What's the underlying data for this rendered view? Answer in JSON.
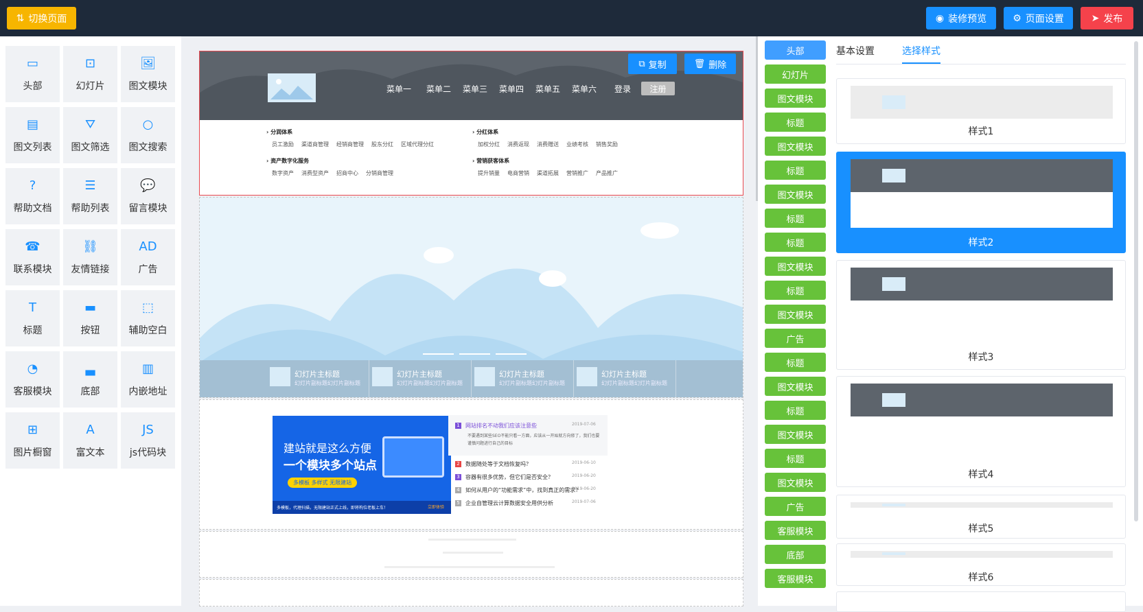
{
  "toolbar": {
    "switch_label": "切换页面",
    "preview_label": "装修预览",
    "settings_label": "页面设置",
    "publish_label": "发布"
  },
  "modules": [
    "头部",
    "幻灯片",
    "图文模块",
    "图文列表",
    "图文筛选",
    "图文搜索",
    "帮助文档",
    "帮助列表",
    "留言模块",
    "联系模块",
    "友情链接",
    "广告",
    "标题",
    "按钮",
    "辅助空白",
    "客服模块",
    "底部",
    "内嵌地址",
    "图片橱窗",
    "富文本",
    "js代码块"
  ],
  "module_icons": [
    "header-icon",
    "slideshow-icon",
    "image-text-icon",
    "image-list-icon",
    "filter-icon",
    "search-icon",
    "help-doc-icon",
    "help-list-icon",
    "message-icon",
    "contact-icon",
    "link-icon",
    "ad-icon",
    "title-icon",
    "button-icon",
    "blank-icon",
    "service-icon",
    "footer-icon",
    "embed-icon",
    "gallery-icon",
    "rich-text-icon",
    "js-code-icon"
  ],
  "canvas": {
    "copy_label": "复制",
    "delete_label": "删除",
    "menus": [
      "菜单一",
      "菜单二",
      "菜单三",
      "菜单四",
      "菜单五",
      "菜单六"
    ],
    "login": "登录",
    "register": "注册",
    "dropdown": [
      {
        "title": "分润体系",
        "items": [
          "员工激励",
          "渠道商管理",
          "经销商管理",
          "股东分红",
          "区域代理分红"
        ]
      },
      {
        "title": "分红体系",
        "items": [
          "加权分红",
          "消费返现",
          "消费赠送",
          "业绩考核",
          "销售奖励"
        ]
      },
      {
        "title": "资产数字化服务",
        "items": [
          "数字资产",
          "消费型资产",
          "招商中心",
          "分销商管理"
        ]
      },
      {
        "title": "营销获客体系",
        "items": [
          "提升销量",
          "电商营销",
          "渠道拓展",
          "营销推广",
          "产品推广"
        ]
      }
    ],
    "slides": [
      {
        "title": "幻灯片主标题",
        "sub": "幻灯片副标题幻灯片副标题"
      },
      {
        "title": "幻灯片主标题",
        "sub": "幻灯片副标题幻灯片副标题"
      },
      {
        "title": "幻灯片主标题",
        "sub": "幻灯片副标题幻灯片副标题"
      },
      {
        "title": "幻灯片主标题",
        "sub": "幻灯片副标题幻灯片副标题"
      }
    ],
    "banner": {
      "line1": "建站就是这么方便",
      "line2": "一个模块多个站点",
      "tag": "多模板 多样式 无限建站",
      "foot": "多模板，代理扫描，无限建站正式上线，即将构位老板上车！",
      "foot_btn": "立即体验"
    },
    "news": [
      {
        "n": "1",
        "title": "网站排名不动我们应该注意些",
        "date": "2019-07-06",
        "desc": "不要遇到某些SEO不能只看一方面，应该从一开始就方向修了，我们也要谨慎问题进行自己的目标"
      },
      {
        "n": "2",
        "title": "数据随处等于文档恢复吗？",
        "date": "2019-06-10"
      },
      {
        "n": "3",
        "title": "容器有很多优势，但它们是否安全？",
        "date": "2019-06-20"
      },
      {
        "n": "4",
        "title": "如何从用户的“功能需求”中，找到真正的需求？",
        "date": "2019-06-20"
      },
      {
        "n": "5",
        "title": "企业自管理云计算数据安全用供分析",
        "date": "2019-07-06"
      }
    ]
  },
  "chips": [
    "头部",
    "幻灯片",
    "图文模块",
    "标题",
    "图文模块",
    "标题",
    "图文模块",
    "标题",
    "标题",
    "图文模块",
    "标题",
    "图文模块",
    "广告",
    "标题",
    "图文模块",
    "标题",
    "图文模块",
    "标题",
    "图文模块",
    "广告",
    "客服模块",
    "底部",
    "客服模块"
  ],
  "tabs": {
    "basic": "基本设置",
    "style": "选择样式"
  },
  "styles": [
    "样式1",
    "样式2",
    "样式3",
    "样式4",
    "样式5",
    "样式6"
  ],
  "colors": {
    "topbar": "#1e2a3a",
    "primary": "#1890ff",
    "warning": "#f7b500",
    "danger": "#f5424b",
    "success": "#67c23a",
    "selected_chip": "#409eff"
  }
}
